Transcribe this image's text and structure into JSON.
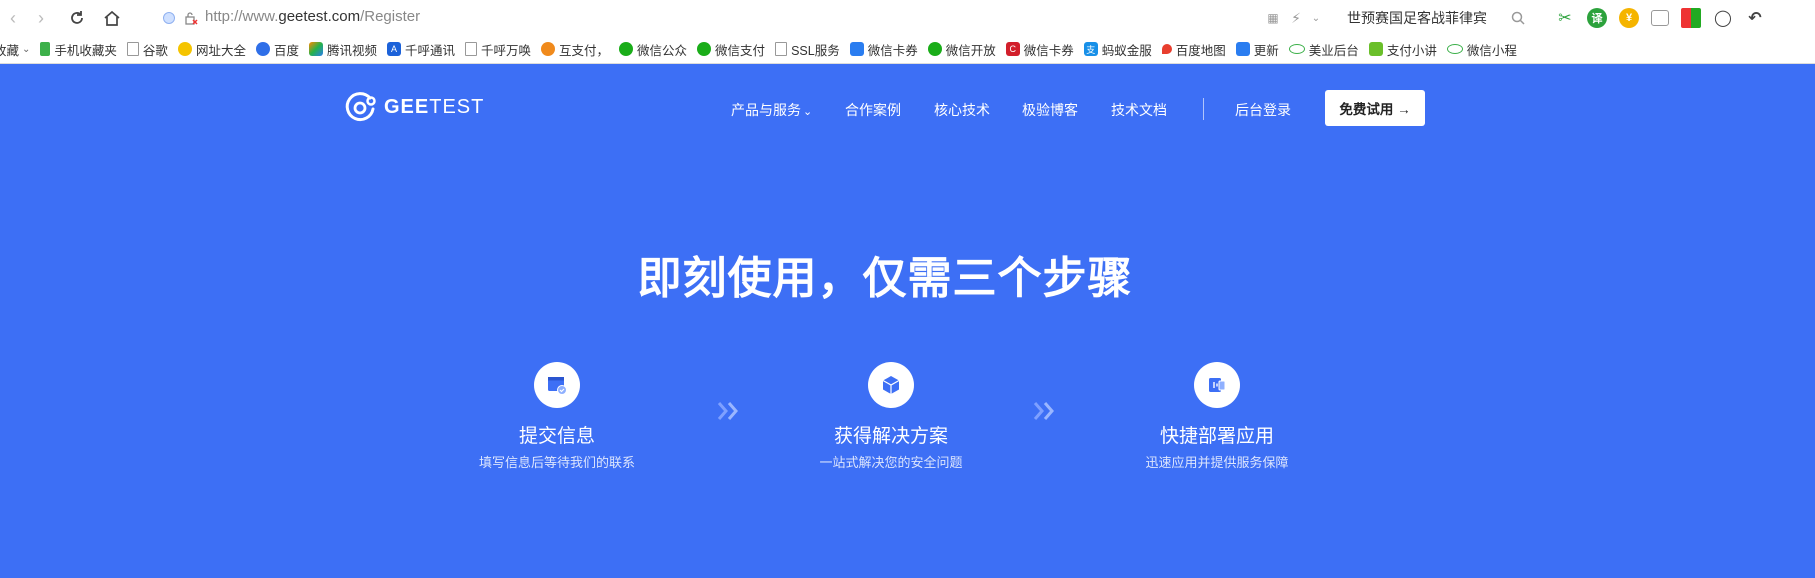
{
  "browser": {
    "url_protocol": "http://www.",
    "url_domain": "geetest.com",
    "url_path": "/Register",
    "search_text": "世预赛国足客战菲律宾",
    "bookmarks": [
      {
        "label": "收藏",
        "icon": "chevron-down-icon"
      },
      {
        "label": "手机收藏夹",
        "icon": "phone-icon"
      },
      {
        "label": "谷歌",
        "icon": "document-icon"
      },
      {
        "label": "网址大全",
        "icon": "globe-icon"
      },
      {
        "label": "百度",
        "icon": "paw-icon"
      },
      {
        "label": "腾讯视频",
        "icon": "video-icon"
      },
      {
        "label": "千呼通讯",
        "icon": "a-logo-icon"
      },
      {
        "label": "千呼万唤",
        "icon": "document-icon"
      },
      {
        "label": "互支付，",
        "icon": "pay-icon"
      },
      {
        "label": "微信公众",
        "icon": "wechat-icon"
      },
      {
        "label": "微信支付",
        "icon": "wechat-pay-icon"
      },
      {
        "label": "SSL服务",
        "icon": "document-icon"
      },
      {
        "label": "微信卡券",
        "icon": "card-icon"
      },
      {
        "label": "微信开放",
        "icon": "wechat-icon"
      },
      {
        "label": "微信卡券",
        "icon": "c-logo-icon"
      },
      {
        "label": "蚂蚁金服",
        "icon": "alipay-icon"
      },
      {
        "label": "百度地图",
        "icon": "map-pin-icon"
      },
      {
        "label": "更新",
        "icon": "card-icon"
      },
      {
        "label": "美业后台",
        "icon": "cloud-icon"
      },
      {
        "label": "支付小讲",
        "icon": "leaf-icon"
      },
      {
        "label": "微信小程",
        "icon": "cloud-icon"
      }
    ]
  },
  "header": {
    "logo_text_bold": "GEE",
    "logo_text_light": "TEST",
    "nav": [
      {
        "label": "产品与服务"
      },
      {
        "label": "合作案例"
      },
      {
        "label": "核心技术"
      },
      {
        "label": "极验博客"
      },
      {
        "label": "技术文档"
      },
      {
        "label": "后台登录"
      }
    ],
    "cta_label": "免费试用 →"
  },
  "hero": {
    "title": "即刻使用，仅需三个步骤",
    "steps": [
      {
        "title": "提交信息",
        "desc": "填写信息后等待我们的联系",
        "icon": "form-check-icon"
      },
      {
        "title": "获得解决方案",
        "desc": "一站式解决您的安全问题",
        "icon": "box-icon"
      },
      {
        "title": "快捷部署应用",
        "desc": "迅速应用并提供服务保障",
        "icon": "deploy-icon"
      }
    ]
  },
  "colors": {
    "brand_blue": "#3d6ff5",
    "white": "#ffffff"
  }
}
